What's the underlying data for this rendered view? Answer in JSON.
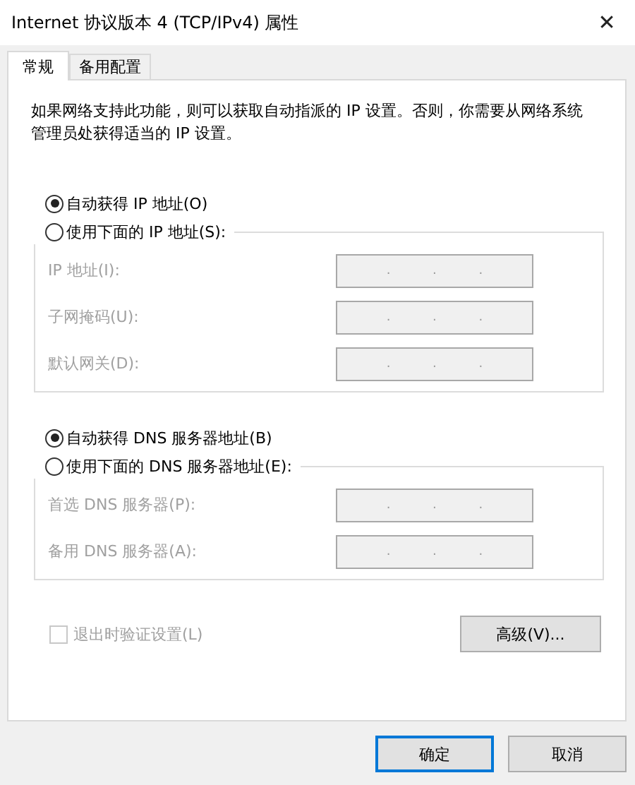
{
  "window": {
    "title": "Internet 协议版本 4 (TCP/IPv4) 属性",
    "close": "✕"
  },
  "tabs": [
    {
      "label": "常规",
      "selected": true
    },
    {
      "label": "备用配置",
      "selected": false
    }
  ],
  "description": "如果网络支持此功能，则可以获取自动指派的 IP 设置。否则，你需要从网络系统管理员处获得适当的 IP 设置。",
  "sections": [
    {
      "auto": {
        "label": "自动获得 IP 地址(O)",
        "selected": true
      },
      "manual": {
        "label": "使用下面的 IP 地址(S):",
        "selected": false
      },
      "disabled": true,
      "fields": [
        {
          "label": "IP 地址(I):",
          "dots": [
            ".",
            ".",
            "."
          ]
        },
        {
          "label": "子网掩码(U):",
          "dots": [
            ".",
            ".",
            "."
          ]
        },
        {
          "label": "默认网关(D):",
          "dots": [
            ".",
            ".",
            "."
          ]
        }
      ]
    },
    {
      "auto": {
        "label": "自动获得 DNS 服务器地址(B)",
        "selected": true
      },
      "manual": {
        "label": "使用下面的 DNS 服务器地址(E):",
        "selected": false
      },
      "disabled": true,
      "fields": [
        {
          "label": "首选 DNS 服务器(P):",
          "dots": [
            ".",
            ".",
            "."
          ]
        },
        {
          "label": "备用 DNS 服务器(A):",
          "dots": [
            ".",
            ".",
            "."
          ]
        }
      ]
    }
  ],
  "validate": {
    "label": "退出时验证设置(L)",
    "checked": false,
    "disabled": true
  },
  "advanced": "高级(V)...",
  "buttons": [
    "确定",
    "取消"
  ]
}
